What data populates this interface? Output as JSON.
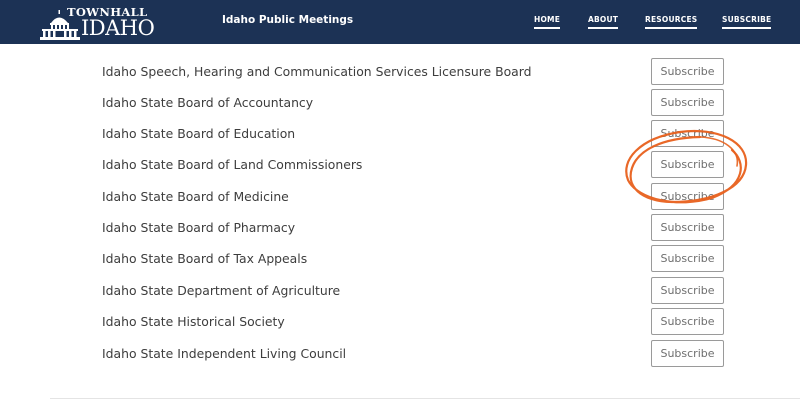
{
  "header": {
    "logo_top": "TOWNHALL",
    "logo_main": "IDAHO",
    "site_title": "Idaho Public Meetings",
    "nav": [
      {
        "label": "HOME"
      },
      {
        "label": "ABOUT"
      },
      {
        "label": "RESOURCES"
      },
      {
        "label": "SUBSCRIBE"
      }
    ]
  },
  "boards": [
    {
      "name": "Idaho Speech, Hearing and Communication Services Licensure Board",
      "button": "Subscribe"
    },
    {
      "name": "Idaho State Board of Accountancy",
      "button": "Subscribe"
    },
    {
      "name": "Idaho State Board of Education",
      "button": "Subscribe"
    },
    {
      "name": "Idaho State Board of Land Commissioners",
      "button": "Subscribe"
    },
    {
      "name": "Idaho State Board of Medicine",
      "button": "Subscribe"
    },
    {
      "name": "Idaho State Board of Pharmacy",
      "button": "Subscribe"
    },
    {
      "name": "Idaho State Board of Tax Appeals",
      "button": "Subscribe"
    },
    {
      "name": "Idaho State Department of Agriculture",
      "button": "Subscribe"
    },
    {
      "name": "Idaho State Historical Society",
      "button": "Subscribe"
    },
    {
      "name": "Idaho State Independent Living Council",
      "button": "Subscribe"
    }
  ],
  "annotation": {
    "icon": "hand-drawn-circle-icon",
    "color": "#e8601c",
    "target_row": 3
  },
  "colors": {
    "header_bg": "#1c3255",
    "text": "#3d3d3d",
    "button_border": "#9a9a9a"
  }
}
